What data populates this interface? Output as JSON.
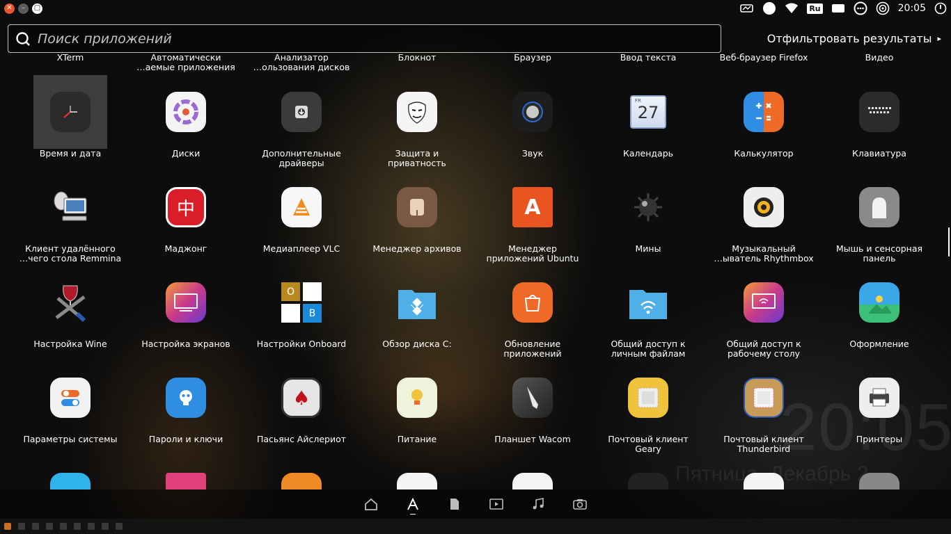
{
  "topbar": {
    "keyboard_layout": "Ru",
    "clock": "20:05"
  },
  "search": {
    "placeholder": "Поиск приложений",
    "filter_label": "Отфильтровать результаты"
  },
  "top_row_labels": [
    "XTerm",
    "Автоматически\n…аемые приложения",
    "Анализатор\n…ользования дисков",
    "Блокнот",
    "Браузер",
    "Ввод текста",
    "Веб-браузер Firefox",
    "Видео"
  ],
  "apps": [
    {
      "label": "Время и дата"
    },
    {
      "label": "Диски"
    },
    {
      "label": "Дополнительные\nдрайверы"
    },
    {
      "label": "Защита и\nприватность"
    },
    {
      "label": "Звук"
    },
    {
      "label": "Календарь",
      "icon_text": "27",
      "icon_small": "FR"
    },
    {
      "label": "Калькулятор"
    },
    {
      "label": "Клавиатура"
    },
    {
      "label": "Клиент удалённого\n…чего стола Remmina"
    },
    {
      "label": "Маджонг",
      "icon_text": "中"
    },
    {
      "label": "Медиаплеер VLC"
    },
    {
      "label": "Менеджер архивов"
    },
    {
      "label": "Менеджер\nприложений Ubuntu",
      "icon_text": "A"
    },
    {
      "label": "Мины"
    },
    {
      "label": "Музыкальный\n…ыватель Rhythmbox"
    },
    {
      "label": "Мышь и сенсорная\nпанель"
    },
    {
      "label": "Настройка Wine"
    },
    {
      "label": "Настройка экранов"
    },
    {
      "label": "Настройки Onboard",
      "icon_o": "O",
      "icon_b": "B"
    },
    {
      "label": "Обзор диска C:"
    },
    {
      "label": "Обновление\nприложений"
    },
    {
      "label": "Общий доступ к\nличным файлам"
    },
    {
      "label": "Общий доступ к\nрабочему столу"
    },
    {
      "label": "Оформление"
    },
    {
      "label": "Параметры системы"
    },
    {
      "label": "Пароли и ключи"
    },
    {
      "label": "Пасьянс Айслериот"
    },
    {
      "label": "Питание"
    },
    {
      "label": "Планшет Wacom"
    },
    {
      "label": "Почтовый клиент\nGeary"
    },
    {
      "label": "Почтовый клиент\nThunderbird"
    },
    {
      "label": "Принтеры"
    }
  ],
  "wallpaper": {
    "clock": "20:05",
    "date": "Пятница, Декабрь 2"
  },
  "colors": {
    "accent_orange": "#e8572d",
    "selection": "rgba(255,255,255,0.2)"
  }
}
